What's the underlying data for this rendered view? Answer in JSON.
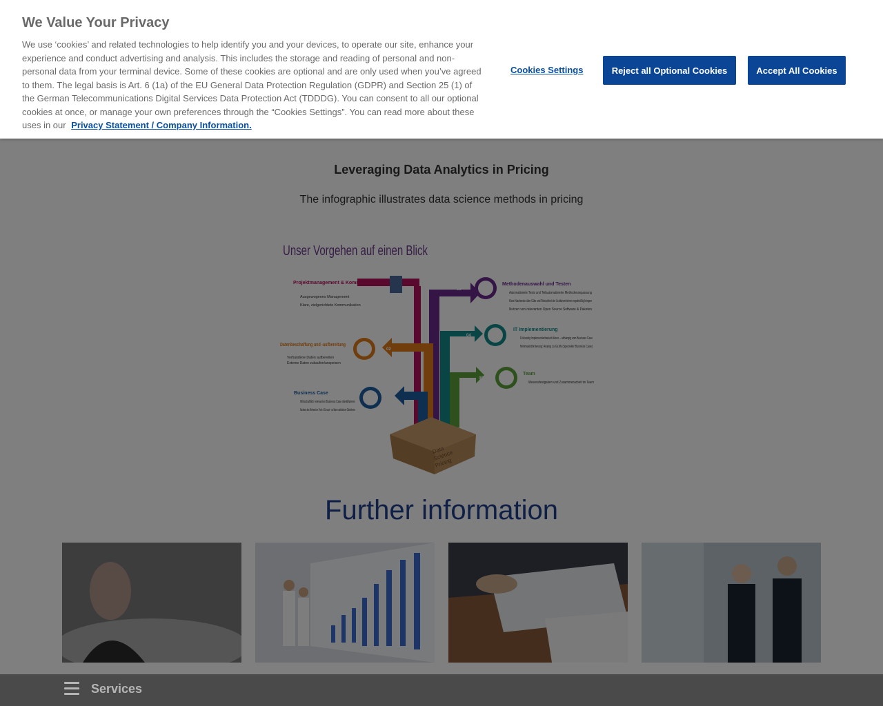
{
  "cookie_banner": {
    "title": "We Value Your Privacy",
    "text": "We use ‘cookies’ and related technologies to help identify you and your devices, to operate our site, enhance your experience and conduct advertising and analysis. This includes the storage and reading of personal and non-personal data from your terminal device. Some of these cookies are optional and are only used when you’ve agreed to them. The legal basis is Art. 6 (1a) of the EU General Data Protection Regulation (GDPR) and Section 25 (1) of the German Telecommunications Digital Services Data Protection Act (TDDDG). You can consent to all our optional cookies at once, or manage your own preferences through the “Cookies Settings”. You can read more about these uses in our",
    "link_label": "Privacy Statement / Company Information.",
    "settings_label": "Cookies Settings",
    "reject_label": "Reject all Optional Cookies",
    "accept_label": "Accept All Cookies"
  },
  "main": {
    "title": "Leveraging Data Analytics in Pricing",
    "subtitle": "The infographic illustrates data science methods in pricing",
    "further_heading": "Further information"
  },
  "infographic": {
    "heading": "Unser Vorgehen auf einen Blick",
    "steps": [
      {
        "num": "",
        "title": "Projektmanagement & Kommunikation",
        "items": [
          "Ausgewogenes Management",
          "Klare, zielgerichtete Kommunikation"
        ],
        "color": "#b0135a"
      },
      {
        "num": "01",
        "title": "Business Case",
        "items": [
          "Wirtschaftlich relevanten Business Case identifizieren",
          "Nachweis des Mehrwerts in Proof of Concept – auf klaren statistischen Gütekriterien"
        ],
        "color": "#1f5fa0"
      },
      {
        "num": "02",
        "title": "Datenbeschaffung und -aufbereitung",
        "items": [
          "Vorhandene Daten aufbereiten",
          "Externe Daten zukaufen/anspeisen"
        ],
        "color": "#e07b1a"
      },
      {
        "num": "03",
        "title": "Methodenauswahl und Testen",
        "items": [
          "Automatisierte Tests und Teilautomatisierte Methodenanpassung",
          "Klare Nachweise über Güte und Robustheit der Schätzverfahren regelmäßig bringen",
          "Nutzen von relevanten Open Source Software & Paketen"
        ],
        "color": "#6a2a8a"
      },
      {
        "num": "04",
        "title": "IT Implementierung",
        "items": [
          "Frühzeitig Implementierbarkeit klären – abhängig vom Business Case",
          "Minimalanforderung: Analog zu GLMs (Spezieller Business Case)"
        ],
        "color": "#138a8a"
      },
      {
        "num": "05",
        "title": "Team",
        "items": [
          "Wesensfestgaben und Zusammenarbeit im Team"
        ],
        "color": "#5aa03a"
      }
    ],
    "box_label": [
      "Data",
      "Science",
      "Pricing"
    ]
  },
  "cards": [
    {
      "alt": "Man looking into distance"
    },
    {
      "alt": "Two men looking at data wall"
    },
    {
      "alt": "Meeting with documents"
    },
    {
      "alt": "Business people walking"
    }
  ],
  "services_bar": {
    "label": "Services",
    "menu_icon": "hamburger-menu-icon"
  }
}
